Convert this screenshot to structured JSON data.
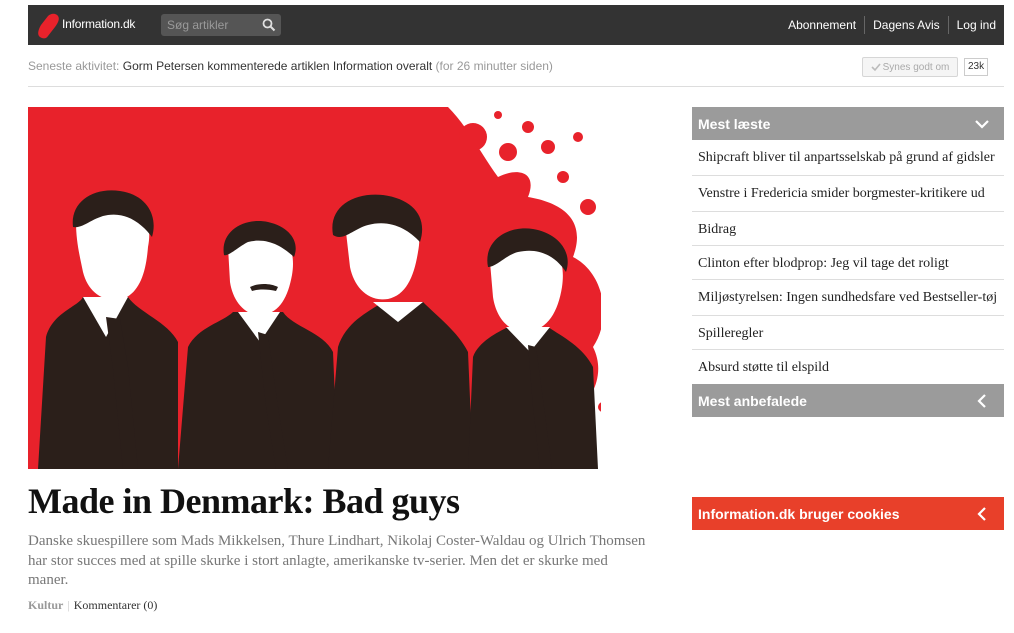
{
  "header": {
    "site_name": "Information.dk",
    "search_placeholder": "Søg artikler",
    "nav": [
      "Abonnement",
      "Dagens Avis",
      "Log ind"
    ]
  },
  "activity": {
    "prefix": "Seneste aktivitet:",
    "text": "Gorm Petersen kommenterede artiklen Information overalt",
    "time": "(for 26 minutter siden)",
    "like_label": "Synes godt om",
    "like_count": "23k"
  },
  "article": {
    "title": "Made in Denmark: Bad guys",
    "lead": "Danske skuespillere som Mads Mikkelsen, Thure Lindhart, Nikolaj Coster-Waldau og Ulrich Thomsen har stor succes med at spille skurke i stort anlagte, amerikanske tv-serier. Men det er skurke med maner.",
    "category": "Kultur",
    "comments": "Kommentarer (0)"
  },
  "sidebar": {
    "most_read_title": "Mest læste",
    "most_read": [
      "Shipcraft bliver til anpartsselskab på grund af gidsler",
      "Venstre i Fredericia smider borgmester-kritikere ud",
      "Bidrag",
      "Clinton efter blodprop: Jeg vil tage det roligt",
      "Miljøstyrelsen: Ingen sundhedsfare ved Bestseller-tøj",
      "Spilleregler",
      "Absurd støtte til elspild"
    ],
    "recommended_title": "Mest anbefalede",
    "cookie_title": "Information.dk bruger cookies"
  },
  "colors": {
    "topbar": "#333333",
    "brand_red": "#e8222b",
    "panel_grey": "#9b9b9b",
    "cookie_red": "#e8402a"
  },
  "icons": {
    "search": "search-icon",
    "like": "check-icon",
    "collapse": "chevron-down-icon",
    "expand": "chevron-left-icon"
  }
}
